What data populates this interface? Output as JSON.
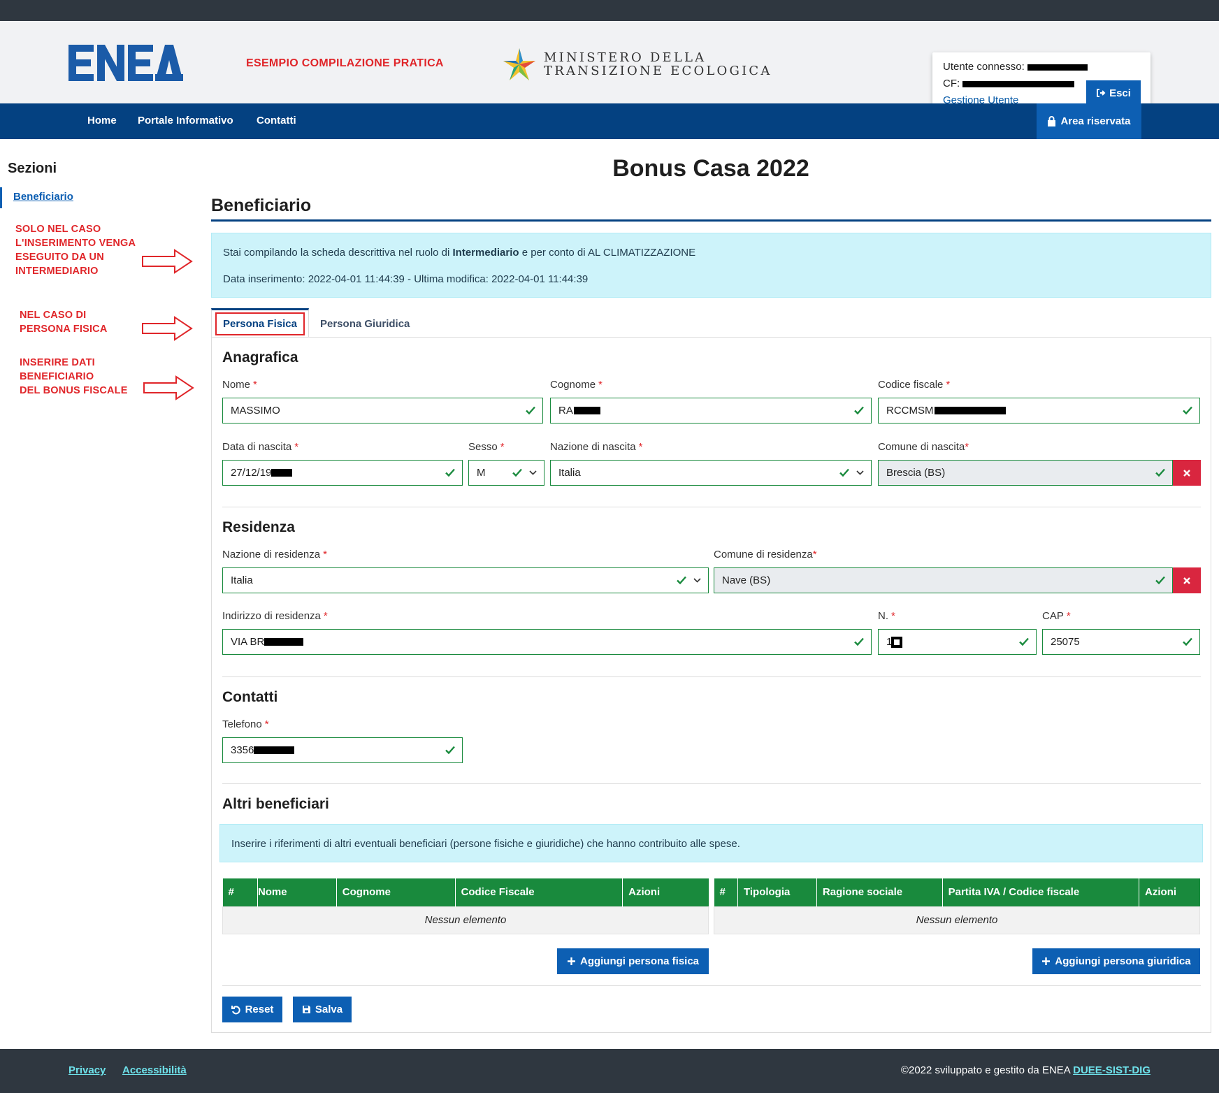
{
  "header": {
    "sample_label": "ESEMPIO COMPILAZIONE PRATICA",
    "logo_text": "ENEA",
    "ministry_line1": "MINISTERO DELLA",
    "ministry_line2": "TRANSIZIONE ECOLOGICA",
    "user_label": "Utente connesso:",
    "cf_label": "CF:",
    "manage_user_link": "Gestione Utente",
    "logout_label": "Esci"
  },
  "nav": {
    "items": [
      "Home",
      "Portale Informativo",
      "Contatti"
    ],
    "reserved_area": "Area riservata"
  },
  "sidebar": {
    "title": "Sezioni",
    "items": [
      "Beneficiario"
    ]
  },
  "annotations": {
    "a1": [
      "SOLO NEL CASO",
      "L'INSERIMENTO VENGA",
      "ESEGUITO DA UN",
      "INTERMEDIARIO"
    ],
    "a2": [
      "NEL CASO DI",
      "PERSONA FISICA"
    ],
    "a3": [
      "INSERIRE DATI",
      "BENEFICIARIO",
      "DEL BONUS FISCALE"
    ]
  },
  "main": {
    "page_title": "Bonus Casa 2022",
    "section_title": "Beneficiario",
    "info": {
      "prefix": "Stai compilando la scheda descrittiva nel ruolo di ",
      "role": "Intermediario",
      "suffix": " e per conto di AL CLIMATIZZAZIONE",
      "dates": "Data inserimento: 2022-04-01 11:44:39 - Ultima modifica: 2022-04-01 11:44:39"
    },
    "tabs": [
      "Persona Fisica",
      "Persona Giuridica"
    ]
  },
  "anagrafica": {
    "title": "Anagrafica",
    "nome": {
      "label": "Nome",
      "value": "MASSIMO"
    },
    "cognome": {
      "label": "Cognome",
      "value": "RA"
    },
    "codice_fiscale": {
      "label": "Codice fiscale",
      "value": "RCCMSM"
    },
    "data_nascita": {
      "label": "Data di nascita",
      "value": "27/12/19"
    },
    "sesso": {
      "label": "Sesso",
      "value": "M"
    },
    "nazione_nascita": {
      "label": "Nazione di nascita",
      "value": "Italia"
    },
    "comune_nascita": {
      "label": "Comune di nascita",
      "value": "Brescia (BS)"
    }
  },
  "residenza": {
    "title": "Residenza",
    "nazione": {
      "label": "Nazione di residenza",
      "value": "Italia"
    },
    "comune": {
      "label": "Comune di residenza",
      "value": "Nave (BS)"
    },
    "indirizzo": {
      "label": "Indirizzo di residenza",
      "value": "VIA BR"
    },
    "numero": {
      "label": "N.",
      "value": "1"
    },
    "cap": {
      "label": "CAP",
      "value": "25075"
    }
  },
  "contatti": {
    "title": "Contatti",
    "telefono": {
      "label": "Telefono",
      "value": "3356"
    }
  },
  "altri": {
    "title": "Altri beneficiari",
    "info": "Inserire i riferimenti di altri eventuali beneficiari (persone fisiche e giuridiche) che hanno contribuito alle spese.",
    "table_fisica": {
      "headers": [
        "#",
        "Nome",
        "Cognome",
        "Codice Fiscale",
        "Azioni"
      ],
      "empty": "Nessun elemento"
    },
    "table_giuridica": {
      "headers": [
        "#",
        "Tipologia",
        "Ragione sociale",
        "Partita IVA / Codice fiscale",
        "Azioni"
      ],
      "empty": "Nessun elemento"
    },
    "add_fisica": "Aggiungi persona fisica",
    "add_giuridica": "Aggiungi persona giuridica"
  },
  "actions": {
    "reset": "Reset",
    "save": "Salva"
  },
  "footer": {
    "privacy": "Privacy",
    "accessibility": "Accessibilità",
    "copyright": "©2022 sviluppato e gestito da ENEA ",
    "copyright_link": "DUEE-SIST-DIG"
  },
  "colors": {
    "primary": "#0d5fb3",
    "nav": "#044181",
    "success": "#198a3d",
    "danger": "#d9263f",
    "annotation": "#e0262a",
    "info_bg": "#cdf3fa"
  }
}
